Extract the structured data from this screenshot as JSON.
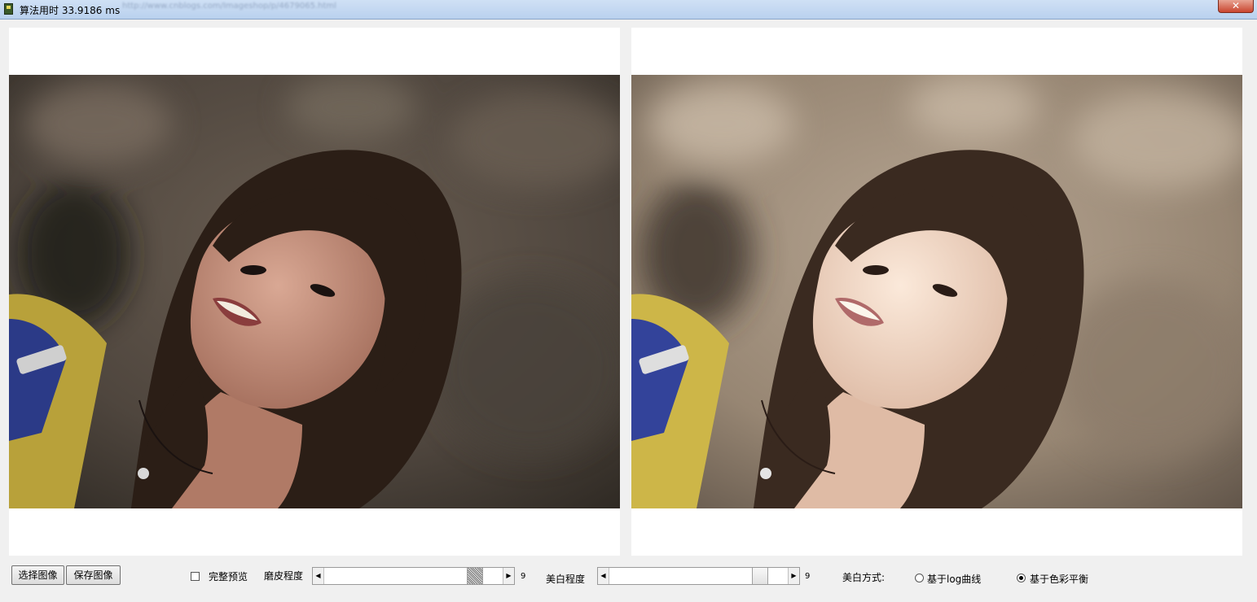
{
  "window": {
    "title": "算法用时 33.9186 ms",
    "blurred_title": "http://www.cnblogs.com/Imageshop/p/4679065.html",
    "close_label": "✕"
  },
  "toolbar": {
    "select_image": "选择图像",
    "save_image": "保存图像",
    "full_preview": "完整预览",
    "full_preview_checked": false,
    "smooth_label": "磨皮程度",
    "smooth_value": "9",
    "smooth_level": 0.78,
    "whiten_label": "美白程度",
    "whiten_value": "9",
    "whiten_level": 0.78,
    "whiten_mode_label": "美白方式:",
    "mode_log_curve": "基于log曲线",
    "mode_color_balance": "基于色彩平衡",
    "selected_mode": "mode_color_balance"
  },
  "images": {
    "original": "original-photo",
    "processed": "processed-photo"
  },
  "colors": {
    "hair": "#2b1e16",
    "background_original": "#5a5048",
    "background_processed": "#a4927f",
    "skin_original": "#c99684",
    "skin_processed": "#f1d9c6",
    "scarf_yellow": "#b8a13a",
    "scarf_blue": "#2b3a87"
  }
}
